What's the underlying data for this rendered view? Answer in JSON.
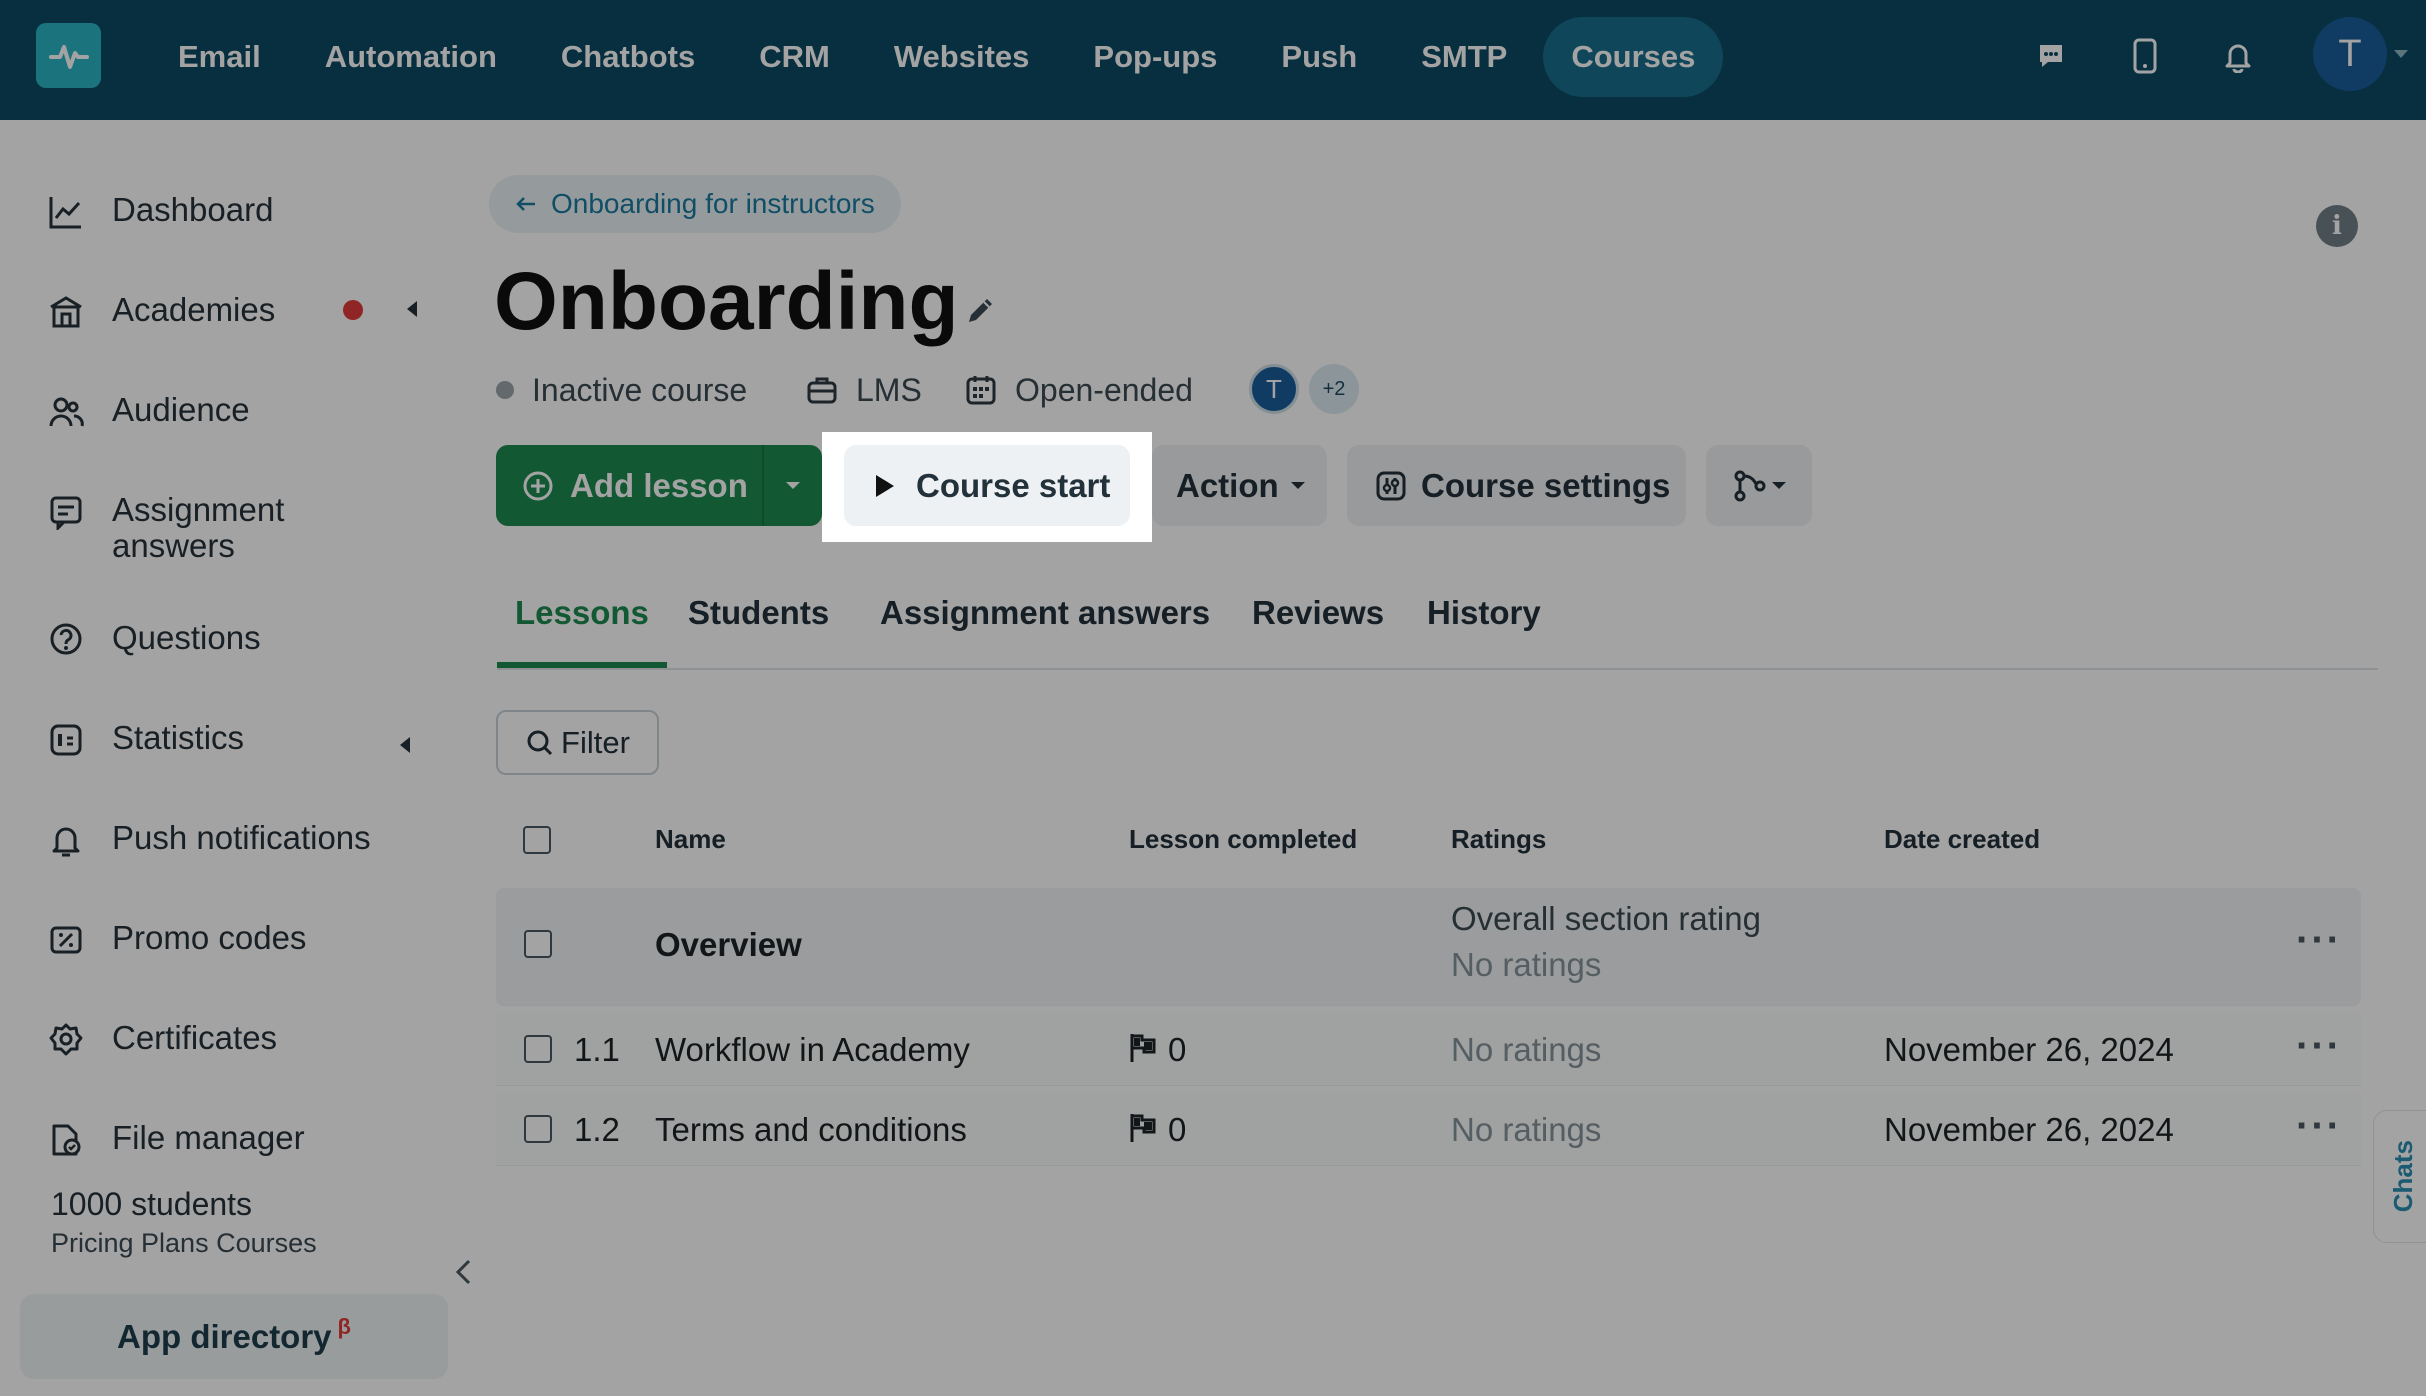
{
  "nav": {
    "items": [
      "Email",
      "Automation",
      "Chatbots",
      "CRM",
      "Websites",
      "Pop-ups",
      "Push",
      "SMTP",
      "Courses"
    ],
    "active": "Courses",
    "avatar_letter": "T"
  },
  "sidebar": {
    "items": [
      {
        "label": "Dashboard",
        "icon": "chart-line-icon"
      },
      {
        "label": "Academies",
        "icon": "academy-building-icon"
      },
      {
        "label": "Audience",
        "icon": "users-icon"
      },
      {
        "label": "Assignment answers",
        "icon": "assignment-icon"
      },
      {
        "label": "Questions",
        "icon": "question-bubble-icon"
      },
      {
        "label": "Statistics",
        "icon": "statistics-icon"
      },
      {
        "label": "Push notifications",
        "icon": "bell-icon"
      },
      {
        "label": "Promo codes",
        "icon": "promo-code-icon"
      },
      {
        "label": "Certificates",
        "icon": "certificate-icon"
      },
      {
        "label": "File manager",
        "icon": "file-manager-icon"
      }
    ],
    "plan_count": "1000 students",
    "plan_name": "Pricing Plans Courses",
    "app_directory": "App directory",
    "app_directory_badge": "β"
  },
  "main": {
    "breadcrumb": "Onboarding for instructors",
    "title": "Onboarding",
    "meta": {
      "status": "Inactive course",
      "type": "LMS",
      "duration": "Open-ended",
      "avatar_letter": "T",
      "extra_count": "+2"
    },
    "toolbar": {
      "add_lesson": "Add lesson",
      "course_start": "Course start",
      "action": "Action",
      "course_settings": "Course settings"
    },
    "tabs": [
      "Lessons",
      "Students",
      "Assignment answers",
      "Reviews",
      "History"
    ],
    "active_tab": "Lessons",
    "filter_label": "Filter",
    "table": {
      "headers": [
        "Name",
        "Lesson completed",
        "Ratings",
        "Date created"
      ],
      "section": {
        "name": "Overview",
        "rating_label": "Overall section rating",
        "rating_value": "No ratings"
      },
      "rows": [
        {
          "num": "1.1",
          "name": "Workflow in Academy",
          "completed": "0",
          "rating": "No ratings",
          "date": "November 26, 2024"
        },
        {
          "num": "1.2",
          "name": "Terms and conditions",
          "completed": "0",
          "rating": "No ratings",
          "date": "November 26, 2024"
        }
      ]
    }
  },
  "chats_label": "Chats",
  "colors": {
    "topbar": "#0b4a63",
    "accent_green": "#1b8a51",
    "link": "#1a7aa0",
    "notification_dot": "#e03a3a"
  }
}
